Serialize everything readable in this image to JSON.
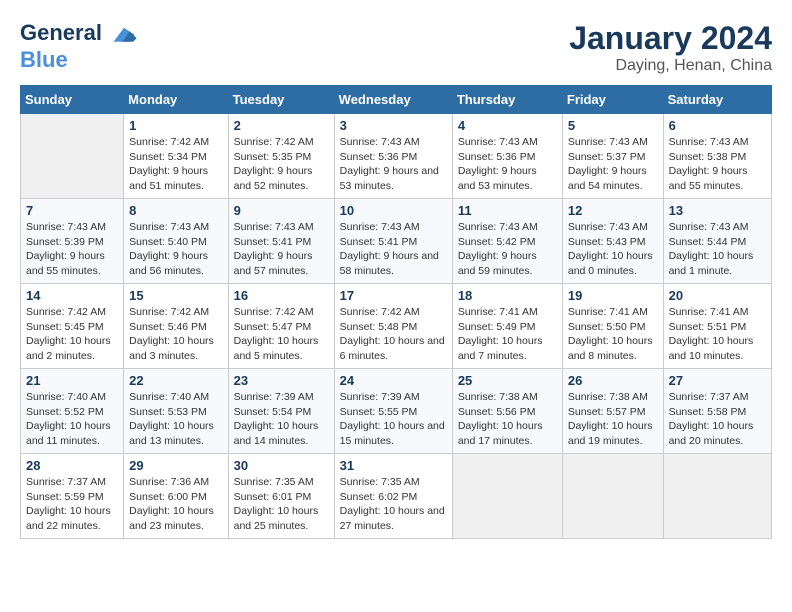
{
  "header": {
    "logo_line1": "General",
    "logo_line2": "Blue",
    "month": "January 2024",
    "location": "Daying, Henan, China"
  },
  "days_of_week": [
    "Sunday",
    "Monday",
    "Tuesday",
    "Wednesday",
    "Thursday",
    "Friday",
    "Saturday"
  ],
  "weeks": [
    [
      {
        "day": "",
        "sunrise": "",
        "sunset": "",
        "daylight": ""
      },
      {
        "day": "1",
        "sunrise": "Sunrise: 7:42 AM",
        "sunset": "Sunset: 5:34 PM",
        "daylight": "Daylight: 9 hours and 51 minutes."
      },
      {
        "day": "2",
        "sunrise": "Sunrise: 7:42 AM",
        "sunset": "Sunset: 5:35 PM",
        "daylight": "Daylight: 9 hours and 52 minutes."
      },
      {
        "day": "3",
        "sunrise": "Sunrise: 7:43 AM",
        "sunset": "Sunset: 5:36 PM",
        "daylight": "Daylight: 9 hours and 53 minutes."
      },
      {
        "day": "4",
        "sunrise": "Sunrise: 7:43 AM",
        "sunset": "Sunset: 5:36 PM",
        "daylight": "Daylight: 9 hours and 53 minutes."
      },
      {
        "day": "5",
        "sunrise": "Sunrise: 7:43 AM",
        "sunset": "Sunset: 5:37 PM",
        "daylight": "Daylight: 9 hours and 54 minutes."
      },
      {
        "day": "6",
        "sunrise": "Sunrise: 7:43 AM",
        "sunset": "Sunset: 5:38 PM",
        "daylight": "Daylight: 9 hours and 55 minutes."
      }
    ],
    [
      {
        "day": "7",
        "sunrise": "Sunrise: 7:43 AM",
        "sunset": "Sunset: 5:39 PM",
        "daylight": "Daylight: 9 hours and 55 minutes."
      },
      {
        "day": "8",
        "sunrise": "Sunrise: 7:43 AM",
        "sunset": "Sunset: 5:40 PM",
        "daylight": "Daylight: 9 hours and 56 minutes."
      },
      {
        "day": "9",
        "sunrise": "Sunrise: 7:43 AM",
        "sunset": "Sunset: 5:41 PM",
        "daylight": "Daylight: 9 hours and 57 minutes."
      },
      {
        "day": "10",
        "sunrise": "Sunrise: 7:43 AM",
        "sunset": "Sunset: 5:41 PM",
        "daylight": "Daylight: 9 hours and 58 minutes."
      },
      {
        "day": "11",
        "sunrise": "Sunrise: 7:43 AM",
        "sunset": "Sunset: 5:42 PM",
        "daylight": "Daylight: 9 hours and 59 minutes."
      },
      {
        "day": "12",
        "sunrise": "Sunrise: 7:43 AM",
        "sunset": "Sunset: 5:43 PM",
        "daylight": "Daylight: 10 hours and 0 minutes."
      },
      {
        "day": "13",
        "sunrise": "Sunrise: 7:43 AM",
        "sunset": "Sunset: 5:44 PM",
        "daylight": "Daylight: 10 hours and 1 minute."
      }
    ],
    [
      {
        "day": "14",
        "sunrise": "Sunrise: 7:42 AM",
        "sunset": "Sunset: 5:45 PM",
        "daylight": "Daylight: 10 hours and 2 minutes."
      },
      {
        "day": "15",
        "sunrise": "Sunrise: 7:42 AM",
        "sunset": "Sunset: 5:46 PM",
        "daylight": "Daylight: 10 hours and 3 minutes."
      },
      {
        "day": "16",
        "sunrise": "Sunrise: 7:42 AM",
        "sunset": "Sunset: 5:47 PM",
        "daylight": "Daylight: 10 hours and 5 minutes."
      },
      {
        "day": "17",
        "sunrise": "Sunrise: 7:42 AM",
        "sunset": "Sunset: 5:48 PM",
        "daylight": "Daylight: 10 hours and 6 minutes."
      },
      {
        "day": "18",
        "sunrise": "Sunrise: 7:41 AM",
        "sunset": "Sunset: 5:49 PM",
        "daylight": "Daylight: 10 hours and 7 minutes."
      },
      {
        "day": "19",
        "sunrise": "Sunrise: 7:41 AM",
        "sunset": "Sunset: 5:50 PM",
        "daylight": "Daylight: 10 hours and 8 minutes."
      },
      {
        "day": "20",
        "sunrise": "Sunrise: 7:41 AM",
        "sunset": "Sunset: 5:51 PM",
        "daylight": "Daylight: 10 hours and 10 minutes."
      }
    ],
    [
      {
        "day": "21",
        "sunrise": "Sunrise: 7:40 AM",
        "sunset": "Sunset: 5:52 PM",
        "daylight": "Daylight: 10 hours and 11 minutes."
      },
      {
        "day": "22",
        "sunrise": "Sunrise: 7:40 AM",
        "sunset": "Sunset: 5:53 PM",
        "daylight": "Daylight: 10 hours and 13 minutes."
      },
      {
        "day": "23",
        "sunrise": "Sunrise: 7:39 AM",
        "sunset": "Sunset: 5:54 PM",
        "daylight": "Daylight: 10 hours and 14 minutes."
      },
      {
        "day": "24",
        "sunrise": "Sunrise: 7:39 AM",
        "sunset": "Sunset: 5:55 PM",
        "daylight": "Daylight: 10 hours and 15 minutes."
      },
      {
        "day": "25",
        "sunrise": "Sunrise: 7:38 AM",
        "sunset": "Sunset: 5:56 PM",
        "daylight": "Daylight: 10 hours and 17 minutes."
      },
      {
        "day": "26",
        "sunrise": "Sunrise: 7:38 AM",
        "sunset": "Sunset: 5:57 PM",
        "daylight": "Daylight: 10 hours and 19 minutes."
      },
      {
        "day": "27",
        "sunrise": "Sunrise: 7:37 AM",
        "sunset": "Sunset: 5:58 PM",
        "daylight": "Daylight: 10 hours and 20 minutes."
      }
    ],
    [
      {
        "day": "28",
        "sunrise": "Sunrise: 7:37 AM",
        "sunset": "Sunset: 5:59 PM",
        "daylight": "Daylight: 10 hours and 22 minutes."
      },
      {
        "day": "29",
        "sunrise": "Sunrise: 7:36 AM",
        "sunset": "Sunset: 6:00 PM",
        "daylight": "Daylight: 10 hours and 23 minutes."
      },
      {
        "day": "30",
        "sunrise": "Sunrise: 7:35 AM",
        "sunset": "Sunset: 6:01 PM",
        "daylight": "Daylight: 10 hours and 25 minutes."
      },
      {
        "day": "31",
        "sunrise": "Sunrise: 7:35 AM",
        "sunset": "Sunset: 6:02 PM",
        "daylight": "Daylight: 10 hours and 27 minutes."
      },
      {
        "day": "",
        "sunrise": "",
        "sunset": "",
        "daylight": ""
      },
      {
        "day": "",
        "sunrise": "",
        "sunset": "",
        "daylight": ""
      },
      {
        "day": "",
        "sunrise": "",
        "sunset": "",
        "daylight": ""
      }
    ]
  ]
}
